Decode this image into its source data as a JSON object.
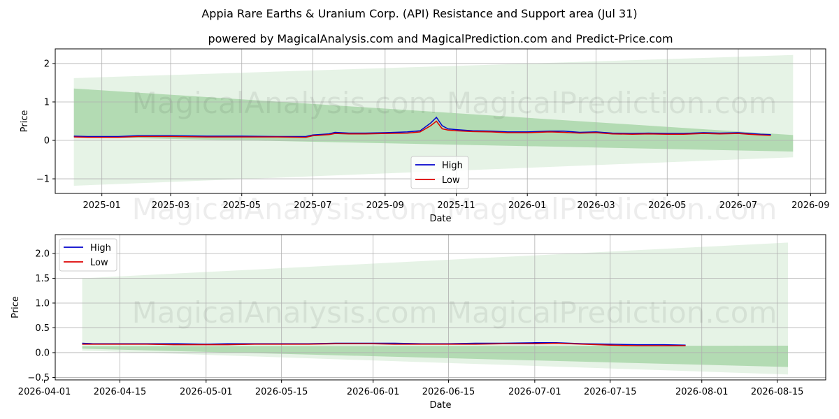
{
  "title": "Appia Rare Earths & Uranium Corp. (API) Resistance and Support area (Jul 31)",
  "subtitle": "powered by MagicalAnalysis.com and MagicalPrediction.com and Predict-Price.com",
  "watermark": "MagicalAnalysis.com    MagicalPrediction.com",
  "colors": {
    "high": "#0000cc",
    "low": "#dd0000",
    "band": "#2e9e2e"
  },
  "chart_data": [
    {
      "type": "line",
      "xlabel": "Date",
      "ylabel": "Price",
      "xlim": [
        "2024-11-22",
        "2026-09-14"
      ],
      "ylim": [
        -1.38,
        2.38
      ],
      "xticks": [
        "2025-01-01",
        "2025-03-01",
        "2025-05-01",
        "2025-07-01",
        "2025-09-01",
        "2025-11-01",
        "2026-01-01",
        "2026-03-01",
        "2026-05-01",
        "2026-07-01",
        "2026-09-01"
      ],
      "xtick_labels": [
        "2025-01",
        "2025-03",
        "2025-05",
        "2025-07",
        "2025-09",
        "2025-11",
        "2026-01",
        "2026-03",
        "2026-05",
        "2026-07",
        "2026-09"
      ],
      "yticks": [
        -1,
        0,
        1,
        2
      ],
      "ytick_labels": [
        "−1",
        "0",
        "1",
        "2"
      ],
      "grid": true,
      "legend": "lower center",
      "bands": [
        {
          "x": [
            "2024-12-08",
            "2026-08-17"
          ],
          "upper": [
            1.62,
            2.22
          ],
          "lower": [
            -1.18,
            -0.44
          ],
          "opacity": 0.12
        },
        {
          "x": [
            "2024-12-08",
            "2026-08-17"
          ],
          "upper": [
            1.35,
            0.14
          ],
          "lower": [
            0.09,
            -0.29
          ],
          "opacity": 0.28
        }
      ],
      "series": [
        {
          "name": "High",
          "x": [
            "2024-12-08",
            "2024-12-20",
            "2025-01-15",
            "2025-02-01",
            "2025-03-01",
            "2025-04-01",
            "2025-05-01",
            "2025-06-01",
            "2025-06-25",
            "2025-07-01",
            "2025-07-15",
            "2025-07-20",
            "2025-08-01",
            "2025-08-15",
            "2025-09-01",
            "2025-09-20",
            "2025-10-01",
            "2025-10-10",
            "2025-10-15",
            "2025-10-20",
            "2025-10-25",
            "2025-11-01",
            "2025-11-15",
            "2025-12-01",
            "2025-12-15",
            "2026-01-01",
            "2026-01-20",
            "2026-02-01",
            "2026-02-15",
            "2026-03-01",
            "2026-03-15",
            "2026-04-01",
            "2026-04-15",
            "2026-05-01",
            "2026-05-15",
            "2026-06-01",
            "2026-06-15",
            "2026-07-01",
            "2026-07-10",
            "2026-07-20",
            "2026-07-29"
          ],
          "values": [
            0.11,
            0.1,
            0.1,
            0.12,
            0.12,
            0.11,
            0.11,
            0.1,
            0.1,
            0.14,
            0.17,
            0.21,
            0.19,
            0.19,
            0.2,
            0.22,
            0.25,
            0.45,
            0.6,
            0.38,
            0.3,
            0.28,
            0.25,
            0.24,
            0.22,
            0.22,
            0.24,
            0.24,
            0.21,
            0.22,
            0.19,
            0.18,
            0.19,
            0.18,
            0.18,
            0.2,
            0.19,
            0.2,
            0.18,
            0.16,
            0.15
          ]
        },
        {
          "name": "Low",
          "x": [
            "2024-12-08",
            "2024-12-20",
            "2025-01-15",
            "2025-02-01",
            "2025-03-01",
            "2025-04-01",
            "2025-05-01",
            "2025-06-01",
            "2025-06-25",
            "2025-07-01",
            "2025-07-15",
            "2025-07-20",
            "2025-08-01",
            "2025-08-15",
            "2025-09-01",
            "2025-09-20",
            "2025-10-01",
            "2025-10-10",
            "2025-10-15",
            "2025-10-20",
            "2025-10-25",
            "2025-11-01",
            "2025-11-15",
            "2025-12-01",
            "2025-12-15",
            "2026-01-01",
            "2026-01-20",
            "2026-02-01",
            "2026-02-15",
            "2026-03-01",
            "2026-03-15",
            "2026-04-01",
            "2026-04-15",
            "2026-05-01",
            "2026-05-15",
            "2026-06-01",
            "2026-06-15",
            "2026-07-01",
            "2026-07-10",
            "2026-07-20",
            "2026-07-29"
          ],
          "values": [
            0.09,
            0.08,
            0.08,
            0.1,
            0.1,
            0.09,
            0.09,
            0.09,
            0.08,
            0.12,
            0.15,
            0.18,
            0.17,
            0.17,
            0.18,
            0.19,
            0.22,
            0.38,
            0.5,
            0.3,
            0.27,
            0.25,
            0.23,
            0.22,
            0.2,
            0.2,
            0.22,
            0.21,
            0.19,
            0.2,
            0.17,
            0.16,
            0.17,
            0.16,
            0.16,
            0.18,
            0.17,
            0.18,
            0.16,
            0.14,
            0.13
          ]
        }
      ]
    },
    {
      "type": "line",
      "xlabel": "Date",
      "ylabel": "Price",
      "xlim": [
        "2026-04-03",
        "2026-08-24"
      ],
      "ylim": [
        -0.55,
        2.38
      ],
      "xticks": [
        "2026-04-01",
        "2026-04-15",
        "2026-05-01",
        "2026-05-15",
        "2026-06-01",
        "2026-06-15",
        "2026-07-01",
        "2026-07-15",
        "2026-08-01",
        "2026-08-15"
      ],
      "xtick_labels": [
        "2026-04-01",
        "2026-04-15",
        "2026-05-01",
        "2026-05-15",
        "2026-06-01",
        "2026-06-15",
        "2026-07-01",
        "2026-07-15",
        "2026-08-01",
        "2026-08-15"
      ],
      "yticks": [
        -0.5,
        0.0,
        0.5,
        1.0,
        1.5,
        2.0
      ],
      "ytick_labels": [
        "−0.5",
        "0.0",
        "0.5",
        "1.0",
        "1.5",
        "2.0"
      ],
      "grid": true,
      "legend": "upper left",
      "bands": [
        {
          "x": [
            "2026-04-08",
            "2026-08-17"
          ],
          "upper": [
            1.5,
            2.22
          ],
          "lower": [
            0.04,
            -0.44
          ],
          "opacity": 0.12
        },
        {
          "x": [
            "2026-04-08",
            "2026-08-17"
          ],
          "upper": [
            0.13,
            0.14
          ],
          "lower": [
            0.08,
            -0.29
          ],
          "opacity": 0.28
        }
      ],
      "series": [
        {
          "name": "High",
          "x": [
            "2026-04-08",
            "2026-04-10",
            "2026-04-15",
            "2026-04-20",
            "2026-04-25",
            "2026-05-01",
            "2026-05-05",
            "2026-05-10",
            "2026-05-15",
            "2026-05-20",
            "2026-05-25",
            "2026-06-01",
            "2026-06-05",
            "2026-06-10",
            "2026-06-15",
            "2026-06-20",
            "2026-06-25",
            "2026-07-01",
            "2026-07-05",
            "2026-07-10",
            "2026-07-15",
            "2026-07-20",
            "2026-07-25",
            "2026-07-29"
          ],
          "values": [
            0.19,
            0.18,
            0.18,
            0.18,
            0.18,
            0.17,
            0.18,
            0.18,
            0.18,
            0.18,
            0.19,
            0.19,
            0.19,
            0.18,
            0.18,
            0.19,
            0.19,
            0.2,
            0.2,
            0.18,
            0.17,
            0.16,
            0.16,
            0.15
          ]
        },
        {
          "name": "Low",
          "x": [
            "2026-04-08",
            "2026-04-10",
            "2026-04-15",
            "2026-04-20",
            "2026-04-25",
            "2026-05-01",
            "2026-05-05",
            "2026-05-10",
            "2026-05-15",
            "2026-05-20",
            "2026-05-25",
            "2026-06-01",
            "2026-06-05",
            "2026-06-10",
            "2026-06-15",
            "2026-06-20",
            "2026-06-25",
            "2026-07-01",
            "2026-07-05",
            "2026-07-10",
            "2026-07-15",
            "2026-07-20",
            "2026-07-25",
            "2026-07-29"
          ],
          "values": [
            0.17,
            0.17,
            0.17,
            0.17,
            0.16,
            0.16,
            0.16,
            0.17,
            0.17,
            0.17,
            0.18,
            0.18,
            0.17,
            0.17,
            0.17,
            0.17,
            0.18,
            0.18,
            0.19,
            0.17,
            0.15,
            0.14,
            0.14,
            0.14
          ]
        }
      ]
    }
  ]
}
